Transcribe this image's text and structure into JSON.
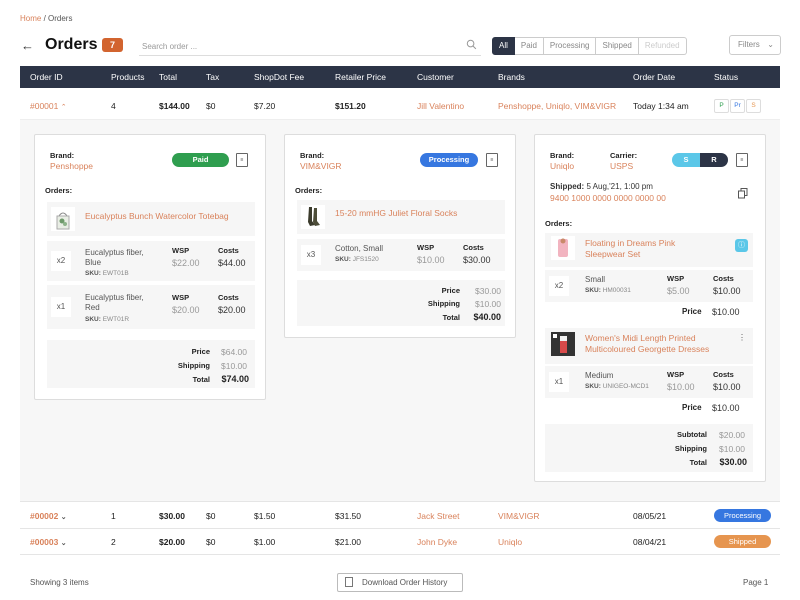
{
  "breadcrumb": {
    "home": "Home",
    "sep": " / ",
    "current": "Orders"
  },
  "header": {
    "title": "Orders",
    "count": "7",
    "search_placeholder": "Search order ...",
    "filters_label": "Filters"
  },
  "status_tabs": [
    {
      "label": "All"
    },
    {
      "label": "Paid"
    },
    {
      "label": "Processing"
    },
    {
      "label": "Shipped"
    },
    {
      "label": "Refunded"
    }
  ],
  "columns": [
    "Order ID",
    "Products",
    "Total",
    "Tax",
    "ShopDot Fee",
    "Retailer Price",
    "Customer",
    "Brands",
    "Order Date",
    "Status"
  ],
  "orders": [
    {
      "id": "#00001",
      "products": "4",
      "total": "$144.00",
      "tax": "$0",
      "fee": "$7.20",
      "retailer_price": "$151.20",
      "customer": "Jill Valentino",
      "brands": "Penshoppe, Uniqlo, VIM&VIGR",
      "date": "Today 1:34 am",
      "status_chips": [
        "P",
        "Pr",
        "S"
      ]
    },
    {
      "id": "#00002",
      "products": "1",
      "total": "$30.00",
      "tax": "$0",
      "fee": "$1.50",
      "retailer_price": "$31.50",
      "customer": "Jack Street",
      "brands": "VIM&VIGR",
      "date": "08/05/21",
      "status": "Processing"
    },
    {
      "id": "#00003",
      "products": "2",
      "total": "$20.00",
      "tax": "$0",
      "fee": "$1.00",
      "retailer_price": "$21.00",
      "customer": "John Dyke",
      "brands": "Uniqlo",
      "date": "08/04/21",
      "status": "Shipped"
    }
  ],
  "labels": {
    "brand": "Brand:",
    "orders": "Orders:",
    "carrier": "Carrier:",
    "shipped": "Shipped:",
    "wsp": "WSP",
    "costs": "Costs",
    "price": "Price",
    "shipping": "Shipping",
    "total": "Total",
    "subtotal": "Subtotal",
    "sku": "SKU:"
  },
  "card1": {
    "brand": "Penshoppe",
    "status": "Paid",
    "product": "Eucalyptus Bunch Watercolor Totebag",
    "variants": [
      {
        "qty": "x2",
        "name": "Eucalyptus fiber, Blue",
        "sku": "EWT01B",
        "wsp": "$22.00",
        "costs": "$44.00"
      },
      {
        "qty": "x1",
        "name": "Eucalyptus fiber, Red",
        "sku": "EWT01R",
        "wsp": "$20.00",
        "costs": "$20.00"
      }
    ],
    "price": "$64.00",
    "shipping": "$10.00",
    "total": "$74.00"
  },
  "card2": {
    "brand": "VIM&VIGR",
    "status": "Processing",
    "product": "15-20 mmHG Juliet Floral Socks",
    "variant": {
      "qty": "x3",
      "name": "Cotton, Small",
      "sku": "JFS1520",
      "wsp": "$10.00",
      "costs": "$30.00"
    },
    "price": "$30.00",
    "shipping": "$10.00",
    "total": "$40.00"
  },
  "card3": {
    "brand": "Uniqlo",
    "carrier": "USPS",
    "status_s": "S",
    "status_r": "R",
    "shipped_date": "5 Aug,'21, 1:00 pm",
    "tracking": "9400 1000 0000 0000 0000 00",
    "products": [
      {
        "name": "Floating in Dreams Pink Sleepwear Set",
        "qty": "x2",
        "variant": "Small",
        "sku": "HM00031",
        "wsp": "$5.00",
        "costs": "$10.00",
        "price": "$10.00"
      },
      {
        "name": "Women's Midi Length Printed Multicoloured Georgette Dresses",
        "qty": "x1",
        "variant": "Medium",
        "sku": "UNIGEO-MCD1",
        "wsp": "$10.00",
        "costs": "$10.00",
        "price": "$10.00"
      }
    ],
    "subtotal": "$20.00",
    "shipping": "$10.00",
    "total": "$30.00"
  },
  "footer": {
    "showing": "Showing 3 items",
    "download": "Download Order History",
    "page": "Page 1"
  },
  "colors": {
    "accent": "#d9825b",
    "navy": "#2c3446",
    "paid": "#2f9e4f",
    "processing": "#3677e0",
    "shipped": "#e6954f",
    "shipped_s": "#5bc7e8"
  }
}
